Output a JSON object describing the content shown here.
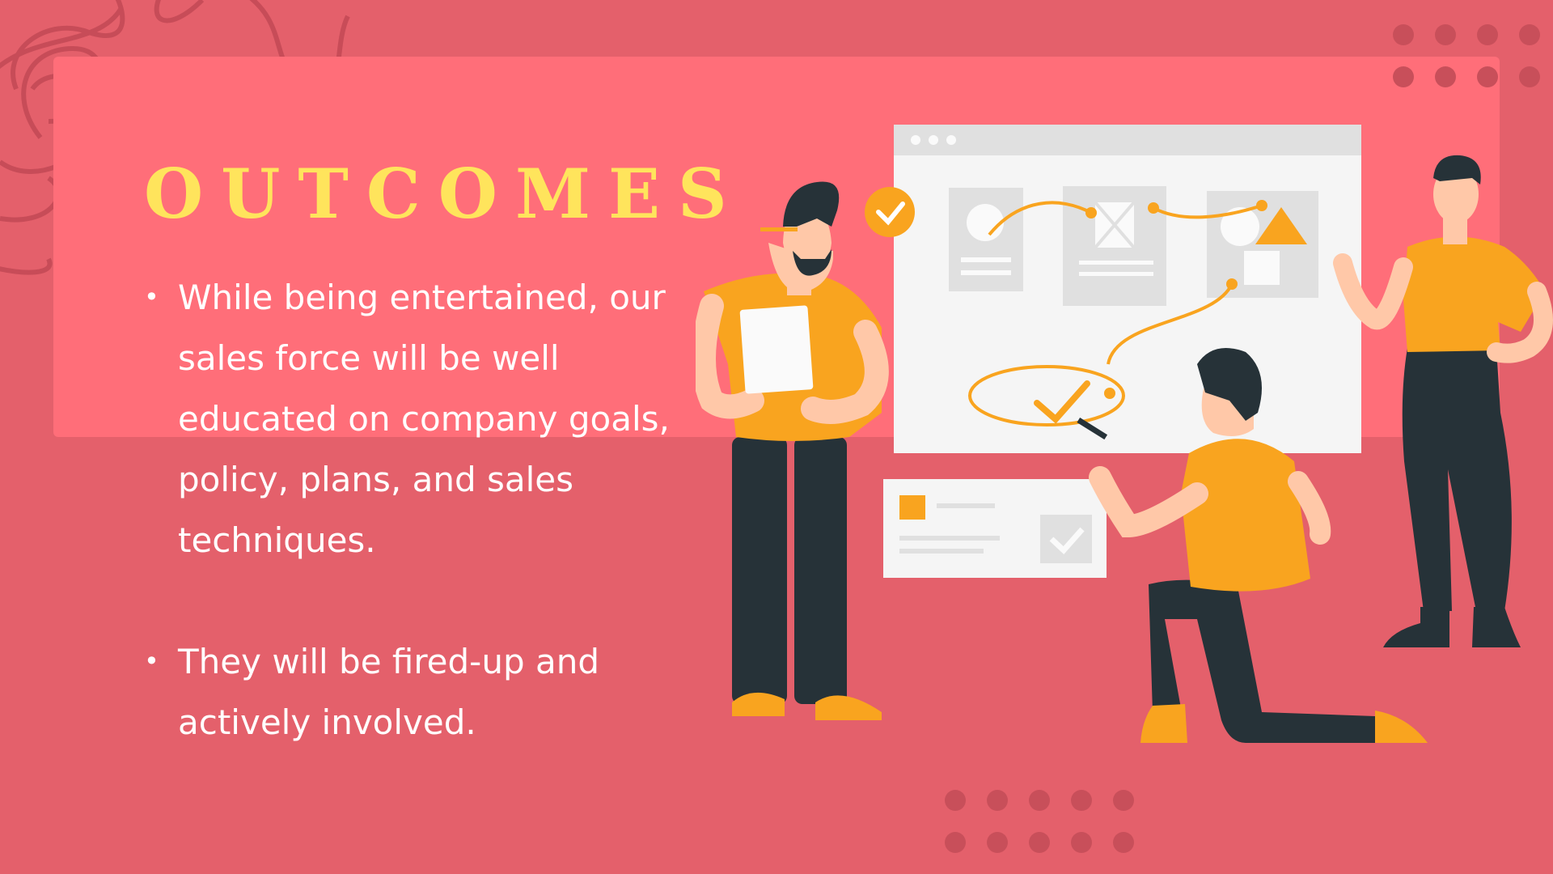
{
  "slide": {
    "title": "OUTCOMES",
    "bullets": [
      "While being entertained, our sales force will be well educated on company goals, policy, plans, and sales techniques.",
      "They will be fired-up and actively involved."
    ]
  },
  "colors": {
    "background": "#e4606b",
    "panel": "#ff6e79",
    "title": "#ffe45c",
    "accent": "#f9a41f",
    "dark": "#263238"
  },
  "illustration": {
    "name": "team-planning-illustration",
    "icons": [
      "check-circle-icon",
      "checkmark-icon",
      "image-placeholder-icon",
      "triangle-icon"
    ]
  }
}
